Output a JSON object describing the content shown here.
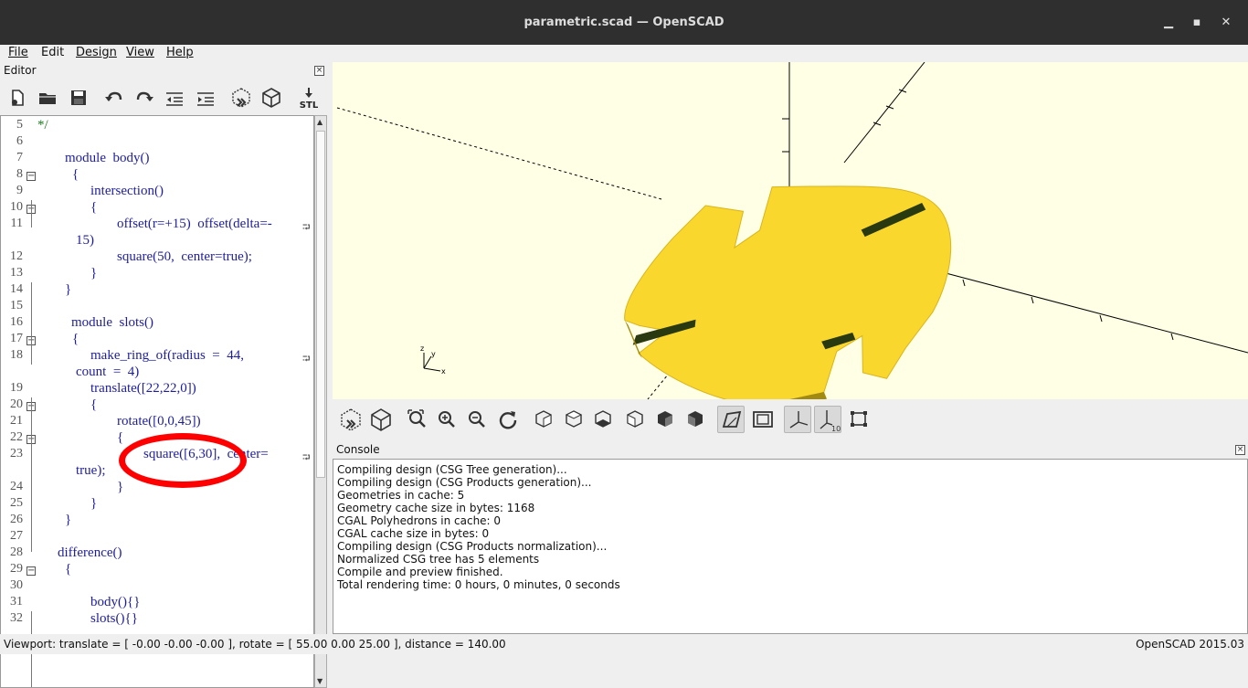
{
  "window": {
    "title": "parametric.scad — OpenSCAD"
  },
  "menu": {
    "file": "File",
    "edit": "Edit",
    "design": "Design",
    "view": "View",
    "help": "Help"
  },
  "editor": {
    "title": "Editor",
    "toolbar": [
      "new-file-icon",
      "open-file-icon",
      "save-icon",
      "undo-icon",
      "redo-icon",
      "unindent-icon",
      "indent-icon",
      "preview-icon",
      "render-icon",
      "export-stl-icon"
    ],
    "stl_label": "STL",
    "lines": [
      {
        "n": "5",
        "text": "*/"
      },
      {
        "n": "6",
        "text": ""
      },
      {
        "n": "7",
        "text": "module  body()"
      },
      {
        "n": "8",
        "text": "{"
      },
      {
        "n": "9",
        "text": "intersection()"
      },
      {
        "n": "10",
        "text": "{"
      },
      {
        "n": "11",
        "text": "offset(r=+15)  offset(delta=-"
      },
      {
        "n": "",
        "text": "15)"
      },
      {
        "n": "12",
        "text": "square(50,  center=true);"
      },
      {
        "n": "13",
        "text": "}"
      },
      {
        "n": "14",
        "text": "}"
      },
      {
        "n": "15",
        "text": ""
      },
      {
        "n": "16",
        "text": "module  slots()"
      },
      {
        "n": "17",
        "text": "{"
      },
      {
        "n": "18",
        "text": "make_ring_of(radius  =  44,"
      },
      {
        "n": "",
        "text": "count  =  4)"
      },
      {
        "n": "19",
        "text": "translate([22,22,0])"
      },
      {
        "n": "20",
        "text": "{"
      },
      {
        "n": "21",
        "text": "rotate([0,0,45])"
      },
      {
        "n": "22",
        "text": "{"
      },
      {
        "n": "23",
        "text": "square([6,30],  center="
      },
      {
        "n": "",
        "text": "true);"
      },
      {
        "n": "24",
        "text": "}"
      },
      {
        "n": "25",
        "text": "}"
      },
      {
        "n": "26",
        "text": "}"
      },
      {
        "n": "27",
        "text": ""
      },
      {
        "n": "28",
        "text": "difference()"
      },
      {
        "n": "29",
        "text": "{"
      },
      {
        "n": "30",
        "text": ""
      },
      {
        "n": "31",
        "text": "body(){}"
      },
      {
        "n": "32",
        "text": "slots(){}"
      }
    ]
  },
  "viewport": {
    "toolbar": [
      "preview-icon",
      "render-icon",
      "view-all-icon",
      "zoom-in-icon",
      "zoom-out-icon",
      "reset-view-icon",
      "view-right-icon",
      "view-top-icon",
      "view-bottom-icon",
      "view-left-icon",
      "view-front-icon",
      "view-back-icon",
      "perspective-icon",
      "orthogonal-icon",
      "show-axes-icon",
      "show-scale-icon",
      "show-edges-icon"
    ],
    "scale_label": "10",
    "axis_labels": {
      "x": "x",
      "y": "y",
      "z": "z"
    }
  },
  "console": {
    "title": "Console",
    "lines": [
      "Compiling design (CSG Tree generation)...",
      "Compiling design (CSG Products generation)...",
      "Geometries in cache: 5",
      "Geometry cache size in bytes: 1168",
      "CGAL Polyhedrons in cache: 0",
      "CGAL cache size in bytes: 0",
      "Compiling design (CSG Products normalization)...",
      "Normalized CSG tree has 5 elements",
      "Compile and preview finished.",
      "Total rendering time: 0 hours, 0 minutes, 0 seconds"
    ]
  },
  "status": {
    "viewport": "Viewport: translate = [ -0.00 -0.00 -0.00 ], rotate = [ 55.00 0.00 25.00 ], distance = 140.00",
    "version": "OpenSCAD 2015.03"
  },
  "colors": {
    "model": "#f9d72c",
    "viewport_bg": "#ffffe5",
    "annotation": "#ff0000"
  }
}
